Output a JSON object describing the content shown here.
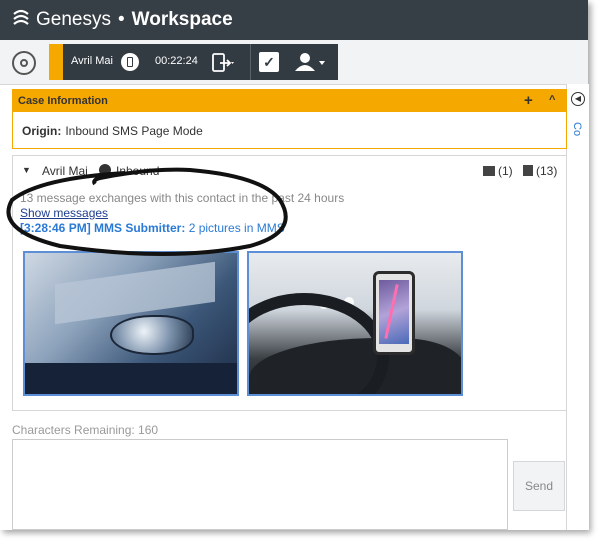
{
  "app": {
    "brand": "Genesys",
    "separator": "•",
    "product": "Workspace"
  },
  "toolbar": {
    "contact_name": "Avril Mai",
    "timer": "00:22:24"
  },
  "case_info": {
    "title": "Case Information",
    "plus": "+",
    "collapse": "^",
    "origin_label": "Origin:",
    "origin_value": "Inbound SMS Page Mode"
  },
  "interaction": {
    "caret": "▼",
    "contact_name": "Avril Mai",
    "direction": "Inbound",
    "case_count": "(1)",
    "history_count": "(13)"
  },
  "transcript": {
    "count_text": "13 message exchanges with this contact in the past 24 hours",
    "show_link": "Show messages",
    "message_time": "[3:28:46 PM] MMS Submitter:",
    "message_body": " 2 pictures in MMS"
  },
  "composer": {
    "chars_remaining": "Characters Remaining: 160",
    "send_label": "Send"
  },
  "right_rail": {
    "label": "Co"
  },
  "colors": {
    "titlebar": "#373f46",
    "accent": "#f5a800",
    "link": "#2a7ad5",
    "image_border": "#5d8fd6"
  }
}
